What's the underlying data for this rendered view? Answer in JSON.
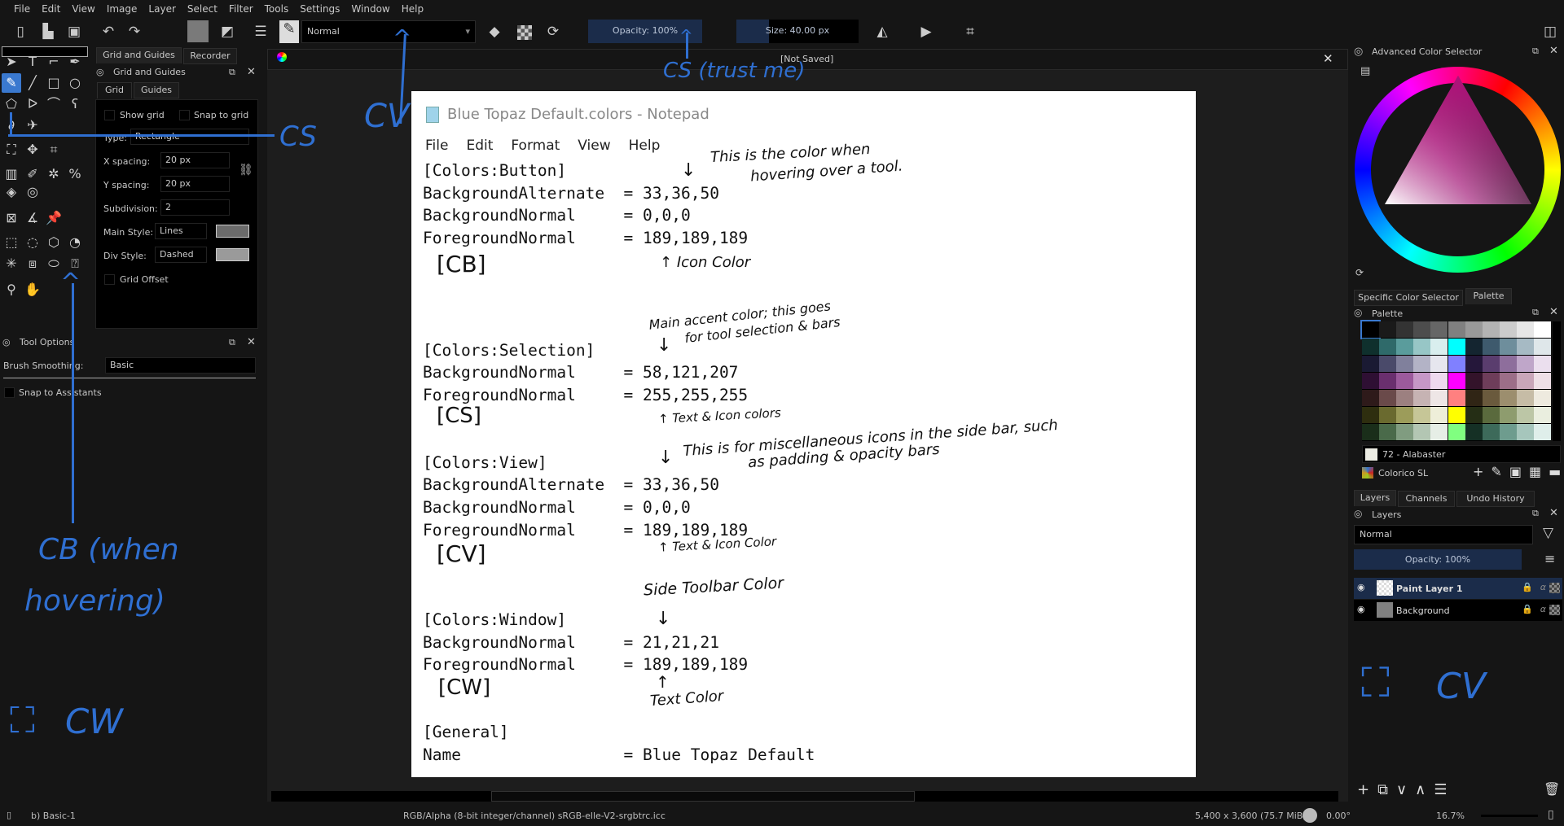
{
  "menu": [
    "File",
    "Edit",
    "View",
    "Image",
    "Layer",
    "Select",
    "Filter",
    "Tools",
    "Settings",
    "Window",
    "Help"
  ],
  "toolbar": {
    "blend_mode": "Normal",
    "opacity": "Opacity: 100%",
    "size": "Size: 40.00 px",
    "icons": [
      "new-document",
      "open-document",
      "save",
      "undo",
      "redo",
      "foreground-color",
      "swap-colors",
      "brush-settings",
      "brush-preset",
      "eraser",
      "alpha-lock",
      "reload",
      "mirror-horizontal",
      "mirror-vertical",
      "wrap-around"
    ]
  },
  "toolbox": {
    "rows": [
      [
        "select-shapes",
        "text",
        "edit-shapes",
        "calligraphy"
      ],
      [
        "freehand-brush",
        "line",
        "rectangle",
        "ellipse"
      ],
      [
        "polygon",
        "polyline",
        "bezier",
        "freehand-path"
      ],
      [
        "dynamic-brush",
        "multibrush"
      ],
      [
        "transform",
        "move",
        "crop"
      ],
      [
        "gradient",
        "color-picker",
        "colorize-mask",
        "smart-patch"
      ],
      [
        "fill",
        "enclose-fill"
      ],
      [
        "assistant",
        "measure",
        "reference"
      ],
      [
        "rect-select",
        "ellipse-select",
        "polygon-select",
        "freehand-select"
      ],
      [
        "contiguous-select",
        "similar-select",
        "bezier-select",
        "magnetic-select"
      ],
      [
        "zoom",
        "pan"
      ]
    ]
  },
  "grid_panel": {
    "tabs": [
      "Grid and Guides",
      "Recorder"
    ],
    "title": "Grid and Guides",
    "subtabs": [
      "Grid",
      "Guides"
    ],
    "show_grid": "Show grid",
    "snap_to_grid": "Snap to grid",
    "type_label": "Type:",
    "type_value": "Rectangle",
    "x_spacing_label": "X spacing:",
    "x_spacing": "20 px",
    "y_spacing_label": "Y spacing:",
    "y_spacing": "20 px",
    "subdivision_label": "Subdivision:",
    "subdivision": "2",
    "main_style_label": "Main Style:",
    "main_style": "Lines",
    "div_style_label": "Div Style:",
    "div_style": "Dashed",
    "grid_offset": "Grid Offset",
    "main_color": "#6b6b6b",
    "div_color": "#9a9a9a"
  },
  "tool_options": {
    "title": "Tool Options",
    "brush_smoothing_label": "Brush Smoothing:",
    "brush_smoothing": "Basic",
    "snap_to_assistants": "Snap to Assistants"
  },
  "canvas": {
    "tab_title": "[Not Saved]"
  },
  "notepad": {
    "title": "Blue Topaz Default.colors - Notepad",
    "menu": [
      "File",
      "Edit",
      "Format",
      "View",
      "Help"
    ],
    "lines": [
      "[Colors:Button]",
      "BackgroundAlternate  = 33,36,50",
      "BackgroundNormal     = 0,0,0",
      "ForegroundNormal     = 189,189,189",
      "",
      "",
      "",
      "",
      "[Colors:Selection]",
      "BackgroundNormal     = 58,121,207",
      "ForegroundNormal     = 255,255,255",
      "",
      "",
      "[Colors:View]",
      "BackgroundAlternate  = 33,36,50",
      "BackgroundNormal     = 0,0,0",
      "ForegroundNormal     = 189,189,189",
      "",
      "",
      "",
      "[Colors:Window]",
      "BackgroundNormal     = 21,21,21",
      "ForegroundNormal     = 189,189,189",
      "",
      "",
      "[General]",
      "Name                 = Blue Topaz Default"
    ],
    "notes": {
      "button_1": "This is the color when",
      "button_2": "hovering over a tool.",
      "button_icon": "Icon Color",
      "cb": "[CB]",
      "sel_1": "Main accent color; this goes",
      "sel_2": "for tool selection & bars",
      "sel_text": "Text & Icon colors",
      "cs": "[CS]",
      "view_1": "This is for miscellaneous icons in the side bar, such",
      "view_2": "as padding & opacity bars",
      "view_text": "Text & Icon Color",
      "cv": "[CV]",
      "window_1": "Side Toolbar Color",
      "window_text": "Text Color",
      "cw": "[CW]"
    }
  },
  "overlay_labels": {
    "cv_top": "CV",
    "cs_top": "CS (trust me)",
    "cs_left": "CS",
    "cb_1": "CB (when",
    "cb_2": "hovering)",
    "cw": "CW",
    "cv_right": "CV"
  },
  "right_panel": {
    "color_selector_title": "Advanced Color Selector",
    "tabs": [
      "Specific Color Selector",
      "Palette"
    ],
    "palette_title": "Palette",
    "palette": [
      [
        "#000000",
        "#1a1a1a",
        "#333333",
        "#4d4d4d",
        "#666666",
        "#808080",
        "#999999",
        "#b3b3b3",
        "#cccccc",
        "#e6e6e6",
        "#ffffff"
      ],
      [
        "#0f302d",
        "#2f6a6a",
        "#5a9c9c",
        "#97c6c6",
        "#d9eeee",
        "#00ffff",
        "#142530",
        "#3e5a6d",
        "#6e8e9c",
        "#a6bac4",
        "#dfe7ea"
      ],
      [
        "#1a1a33",
        "#4a4a6a",
        "#80809c",
        "#b3b3c6",
        "#e6e6ee",
        "#8080ff",
        "#25173a",
        "#5a3d6e",
        "#8e6e9c",
        "#bfa6c9",
        "#ebdfee"
      ],
      [
        "#2e0f33",
        "#6a2f6e",
        "#9c5a9c",
        "#c697c6",
        "#eed9ee",
        "#ff00ff",
        "#33132a",
        "#6e3d5a",
        "#9c6e88",
        "#c9a6b9",
        "#eedfe6"
      ],
      [
        "#2e1a1a",
        "#6a4a4a",
        "#9c8080",
        "#c6b3b3",
        "#eee6e6",
        "#ff8080",
        "#302515",
        "#6a5a3d",
        "#9c8e6e",
        "#c6bca6",
        "#eeeadf"
      ],
      [
        "#2e2e0f",
        "#6a6a2f",
        "#9c9c5a",
        "#c6c697",
        "#eeeed9",
        "#ffff00",
        "#252e15",
        "#5a6a3d",
        "#8e9c6e",
        "#bcc6a6",
        "#eaeedf"
      ],
      [
        "#1a2e1a",
        "#4a6a4a",
        "#809c80",
        "#b3c6b3",
        "#e6eee6",
        "#80ff80",
        "#153025",
        "#3d6a5a",
        "#6e9c8e",
        "#a6c6bc",
        "#dfeeea"
      ]
    ],
    "selected_color": "72 - Alabaster",
    "palette_name": "Colorico SL",
    "layer_tabs": [
      "Layers",
      "Channels",
      "Undo History"
    ],
    "layers_title": "Layers",
    "blend_mode": "Normal",
    "opacity": "Opacity:  100%",
    "layers": [
      {
        "name": "Paint Layer 1",
        "selected": true
      },
      {
        "name": "Background",
        "selected": false
      }
    ]
  },
  "status": {
    "brush": "b) Basic-1",
    "color_space": "RGB/Alpha (8-bit integer/channel)  sRGB-elle-V2-srgbtrc.icc",
    "dimensions": "5,400 x 3,600 (75.7 MiB)",
    "rotation": "0.00°",
    "zoom": "16.7%"
  },
  "colors": {
    "accent": "#3a79cf",
    "annotation": "#2f6fd1",
    "button_alt": "#212432"
  }
}
